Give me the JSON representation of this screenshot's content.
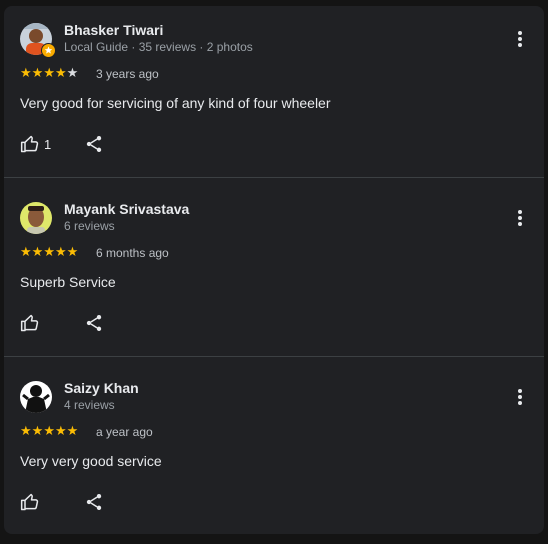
{
  "reviews": [
    {
      "name": "Bhasker Tiwari",
      "meta": "Local Guide · 35 reviews · 2 photos",
      "rating": 4,
      "time": "3 years ago",
      "text": "Very good for servicing of any kind of four wheeler",
      "likes": "1",
      "avatar": "photo-avatar",
      "local_guide": true
    },
    {
      "name": "Mayank Srivastava",
      "meta": "6 reviews",
      "rating": 5,
      "time": "6 months ago",
      "text": "Superb Service",
      "likes": "",
      "avatar": "photo-avatar"
    },
    {
      "name": "Saizy Khan",
      "meta": "4 reviews",
      "rating": 5,
      "time": "a year ago",
      "text": "Very very good service",
      "likes": "",
      "avatar": "silhouette-avatar"
    }
  ],
  "colors": {
    "star": "#fbbc04",
    "star_empty": "#dadce0",
    "background": "#202124",
    "divider": "#3c4043",
    "local_guide_badge": "#f9ab00"
  },
  "icons": {
    "like": "thumb-up-icon",
    "share": "share-icon",
    "more": "more-vert-icon",
    "star": "star-icon"
  }
}
